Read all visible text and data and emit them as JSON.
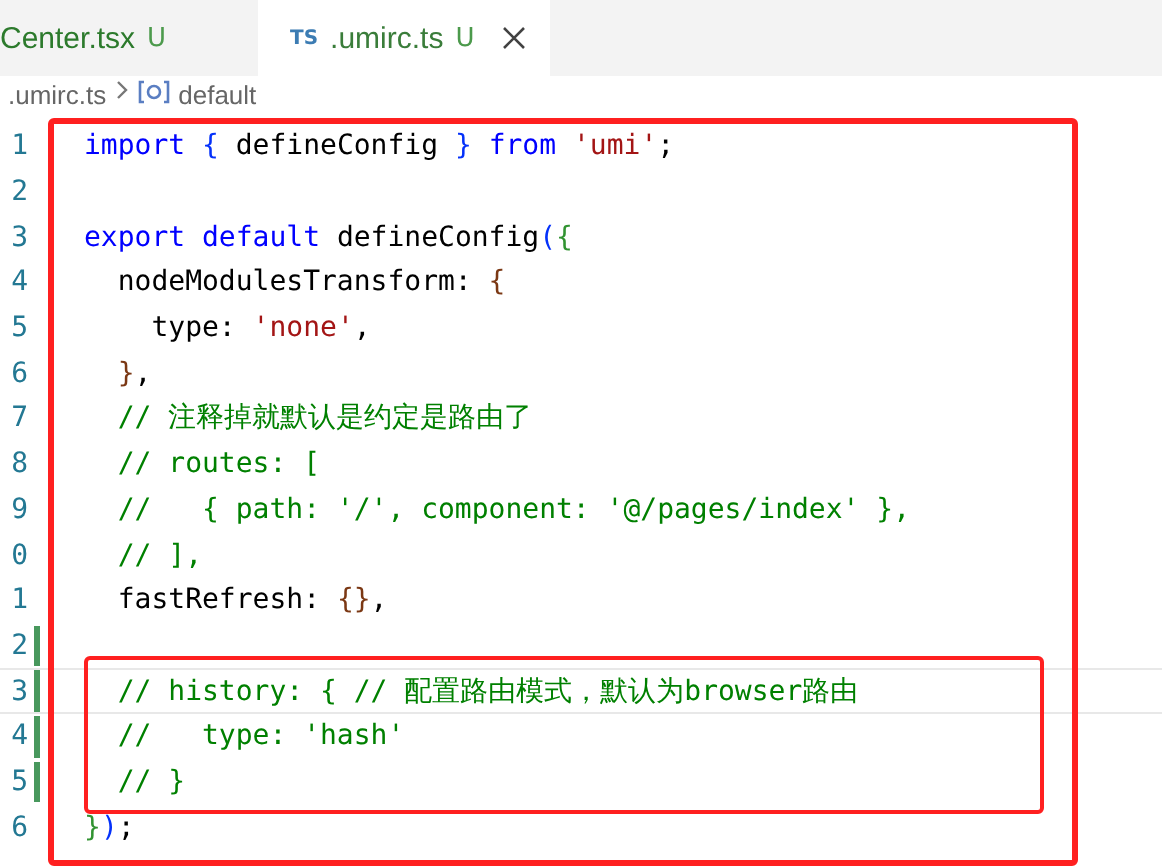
{
  "tabs": [
    {
      "label": "Center.tsx",
      "status": "U",
      "selected": false
    },
    {
      "lang": "TS",
      "label": ".umirc.ts",
      "status": "U",
      "selected": true
    }
  ],
  "breadcrumb": {
    "file": ".umirc.ts",
    "symbol": "default"
  },
  "lines": [
    {
      "number": "1",
      "changed": false,
      "current": false,
      "tokens": [
        {
          "kind": "kw",
          "text": "import"
        },
        {
          "kind": "b1",
          "text": " {"
        },
        {
          "kind": "id",
          "text": " defineConfig "
        },
        {
          "kind": "b1",
          "text": "}"
        },
        {
          "kind": "kw",
          "text": " from"
        },
        {
          "kind": "str",
          "text": " 'umi'"
        },
        {
          "kind": "p",
          "text": ";"
        }
      ]
    },
    {
      "number": "2",
      "changed": false,
      "current": false
    },
    {
      "number": "3",
      "changed": false,
      "current": false,
      "tokens": [
        {
          "kind": "kw",
          "text": "export default"
        },
        {
          "kind": "id",
          "text": " defineConfig"
        },
        {
          "kind": "b1",
          "text": "("
        },
        {
          "kind": "b2",
          "text": "{"
        }
      ]
    },
    {
      "number": "4",
      "changed": false,
      "current": false,
      "tokens": [
        {
          "kind": "id",
          "text": "  nodeModulesTransform: "
        },
        {
          "kind": "b3",
          "text": "{"
        }
      ]
    },
    {
      "number": "5",
      "changed": false,
      "current": false,
      "tokens": [
        {
          "kind": "id",
          "text": "    type: "
        },
        {
          "kind": "str",
          "text": "'none'"
        },
        {
          "kind": "p",
          "text": ","
        }
      ]
    },
    {
      "number": "6",
      "changed": false,
      "current": false,
      "tokens": [
        {
          "kind": "b3",
          "text": "  }"
        },
        {
          "kind": "p",
          "text": ","
        }
      ]
    },
    {
      "number": "7",
      "changed": false,
      "current": false,
      "tokens": [
        {
          "kind": "cmt",
          "text": "  // 注释掉就默认是约定是路由了"
        }
      ]
    },
    {
      "number": "8",
      "changed": false,
      "current": false,
      "tokens": [
        {
          "kind": "cmt",
          "text": "  // routes: ["
        }
      ]
    },
    {
      "number": "9",
      "changed": false,
      "current": false,
      "tokens": [
        {
          "kind": "cmt",
          "text": "  //   { path: '/', component: '@/pages/index' },"
        }
      ]
    },
    {
      "number": "0",
      "changed": false,
      "current": false,
      "tokens": [
        {
          "kind": "cmt",
          "text": "  // ],"
        }
      ]
    },
    {
      "number": "1",
      "changed": false,
      "current": false,
      "tokens": [
        {
          "kind": "id",
          "text": "  fastRefresh: "
        },
        {
          "kind": "b3",
          "text": "{}"
        },
        {
          "kind": "p",
          "text": ","
        }
      ]
    },
    {
      "number": "2",
      "changed": true,
      "current": false
    },
    {
      "number": "3",
      "changed": true,
      "current": true,
      "tokens": [
        {
          "kind": "cmt",
          "text": "  // history: { // 配置路由模式，默认为browser路由"
        }
      ]
    },
    {
      "number": "4",
      "changed": true,
      "current": false,
      "tokens": [
        {
          "kind": "cmt",
          "text": "  //   type: 'hash'"
        }
      ]
    },
    {
      "number": "5",
      "changed": true,
      "current": false,
      "tokens": [
        {
          "kind": "cmt",
          "text": "  // }"
        }
      ]
    },
    {
      "number": "6",
      "changed": false,
      "current": false,
      "tokens": [
        {
          "kind": "b2",
          "text": "}"
        },
        {
          "kind": "b1",
          "text": ")"
        },
        {
          "kind": "p",
          "text": ";"
        }
      ]
    }
  ]
}
